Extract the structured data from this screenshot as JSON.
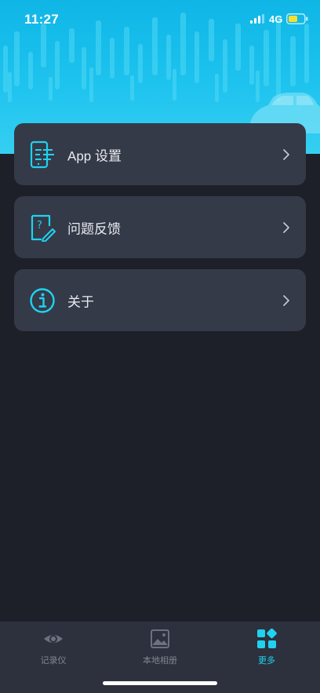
{
  "status_bar": {
    "time": "11:27",
    "network": "4G"
  },
  "menu": {
    "items": [
      {
        "label": "App 设置",
        "icon": "phone-settings-icon"
      },
      {
        "label": "问题反馈",
        "icon": "feedback-icon"
      },
      {
        "label": "关于",
        "icon": "info-icon"
      }
    ]
  },
  "tabbar": {
    "tabs": [
      {
        "label": "记录仪",
        "icon": "dashcam-icon",
        "active": false
      },
      {
        "label": "本地相册",
        "icon": "album-icon",
        "active": false
      },
      {
        "label": "更多",
        "icon": "more-grid-icon",
        "active": true
      }
    ]
  },
  "colors": {
    "accent": "#1fd2f0",
    "background": "#1e2029",
    "card": "#353a48",
    "banner": "#1ec3ee"
  }
}
